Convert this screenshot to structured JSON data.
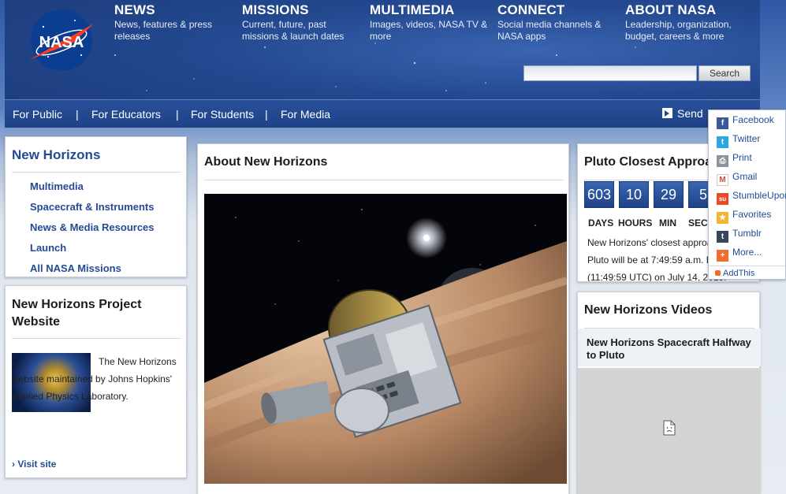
{
  "header": {
    "logo_text": "NASA",
    "nav": [
      {
        "title": "NEWS",
        "desc": "News, features & press releases"
      },
      {
        "title": "MISSIONS",
        "desc": "Current, future, past missions & launch dates"
      },
      {
        "title": "MULTIMEDIA",
        "desc": "Images, videos, NASA TV & more"
      },
      {
        "title": "CONNECT",
        "desc": "Social media channels & NASA apps"
      },
      {
        "title": "ABOUT NASA",
        "desc": "Leadership, organization, budget, careers & more"
      }
    ],
    "search": {
      "value": "",
      "placeholder": "",
      "button": "Search"
    }
  },
  "subnav": {
    "links": [
      "For Public",
      "For Educators",
      "For Students",
      "For Media"
    ],
    "separator": "|",
    "send_label": "Send"
  },
  "sidebar": {
    "title": "New Horizons",
    "items": [
      "Multimedia",
      "Spacecraft & Instruments",
      "News & Media Resources",
      "Launch",
      "All NASA Missions"
    ]
  },
  "project": {
    "title": "New Horizons Project Website",
    "text": "The New Horizons website maintained by Johns Hopkins' Applied Physics Laboratory.",
    "link": "› Visit site"
  },
  "about": {
    "title": "About New Horizons"
  },
  "countdown": {
    "title": "Pluto Closest Approach",
    "values": [
      "603",
      "10",
      "29",
      "5"
    ],
    "labels": [
      "DAYS",
      "HOURS",
      "MIN",
      "SEC"
    ],
    "description": [
      "New Horizons' closest approach to",
      "Pluto will be at 7:49:59 a.m. EDT",
      "(11:49:59 UTC) on July 14, 2015."
    ]
  },
  "videos": {
    "title": "New Horizons Videos",
    "video_title": "New Horizons Spacecraft Halfway to Pluto"
  },
  "share_menu": {
    "items": [
      {
        "label": "Facebook",
        "icon": "facebook-icon",
        "color": "#3b5998",
        "glyph": "f"
      },
      {
        "label": "Twitter",
        "icon": "twitter-icon",
        "color": "#2aa9e0",
        "glyph": "t"
      },
      {
        "label": "Print",
        "icon": "print-icon",
        "color": "#8a949e",
        "glyph": "⎙"
      },
      {
        "label": "Gmail",
        "icon": "gmail-icon",
        "color": "#d24b3e",
        "glyph": "M"
      },
      {
        "label": "StumbleUpon",
        "icon": "stumbleupon-icon",
        "color": "#eb4924",
        "glyph": "su"
      },
      {
        "label": "Favorites",
        "icon": "favorites-icon",
        "color": "#f2b632",
        "glyph": "★"
      },
      {
        "label": "Tumblr",
        "icon": "tumblr-icon",
        "color": "#35465c",
        "glyph": "t"
      },
      {
        "label": "More...",
        "icon": "more-icon",
        "color": "#f26c2c",
        "glyph": "+"
      }
    ],
    "footer": "AddThis"
  }
}
